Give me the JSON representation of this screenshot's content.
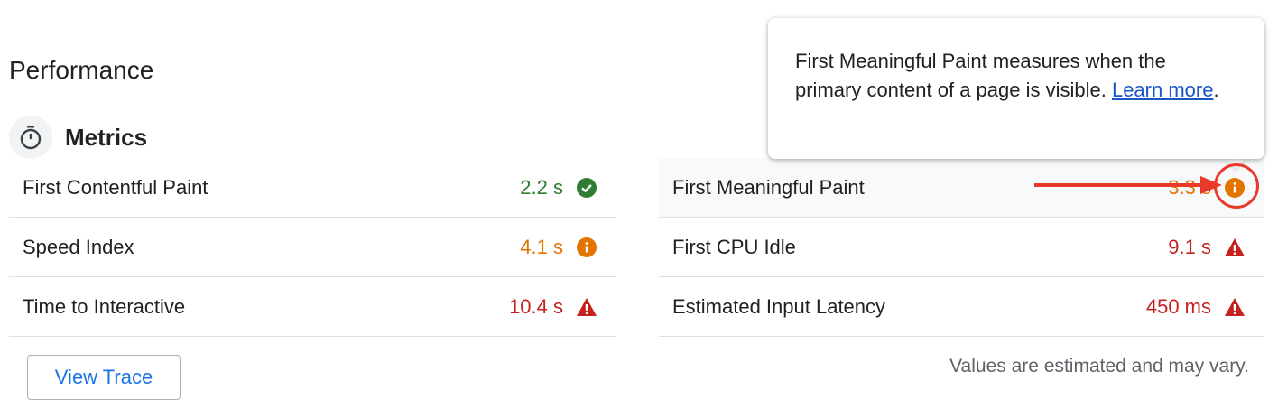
{
  "section": {
    "title": "Performance"
  },
  "metrics": {
    "title": "Metrics",
    "icon": "timer-icon",
    "left": [
      {
        "label": "First Contentful Paint",
        "value": "2.2 s",
        "status": "pass"
      },
      {
        "label": "Speed Index",
        "value": "4.1 s",
        "status": "average"
      },
      {
        "label": "Time to Interactive",
        "value": "10.4 s",
        "status": "fail"
      }
    ],
    "right": [
      {
        "label": "First Meaningful Paint",
        "value": "3.3 s",
        "status": "average"
      },
      {
        "label": "First CPU Idle",
        "value": "9.1 s",
        "status": "fail"
      },
      {
        "label": "Estimated Input Latency",
        "value": "450 ms",
        "status": "fail"
      }
    ]
  },
  "tooltip": {
    "text": "First Meaningful Paint measures when the primary content of a page is visible. ",
    "link": "Learn more",
    "suffix": "."
  },
  "footer": {
    "view_trace_label": "View Trace",
    "note": "Values are estimated and may vary."
  },
  "colors": {
    "pass": "#2e7d32",
    "average": "#e37400",
    "fail": "#c5221f",
    "link": "#1a56c4",
    "annotation": "#e8392a"
  }
}
